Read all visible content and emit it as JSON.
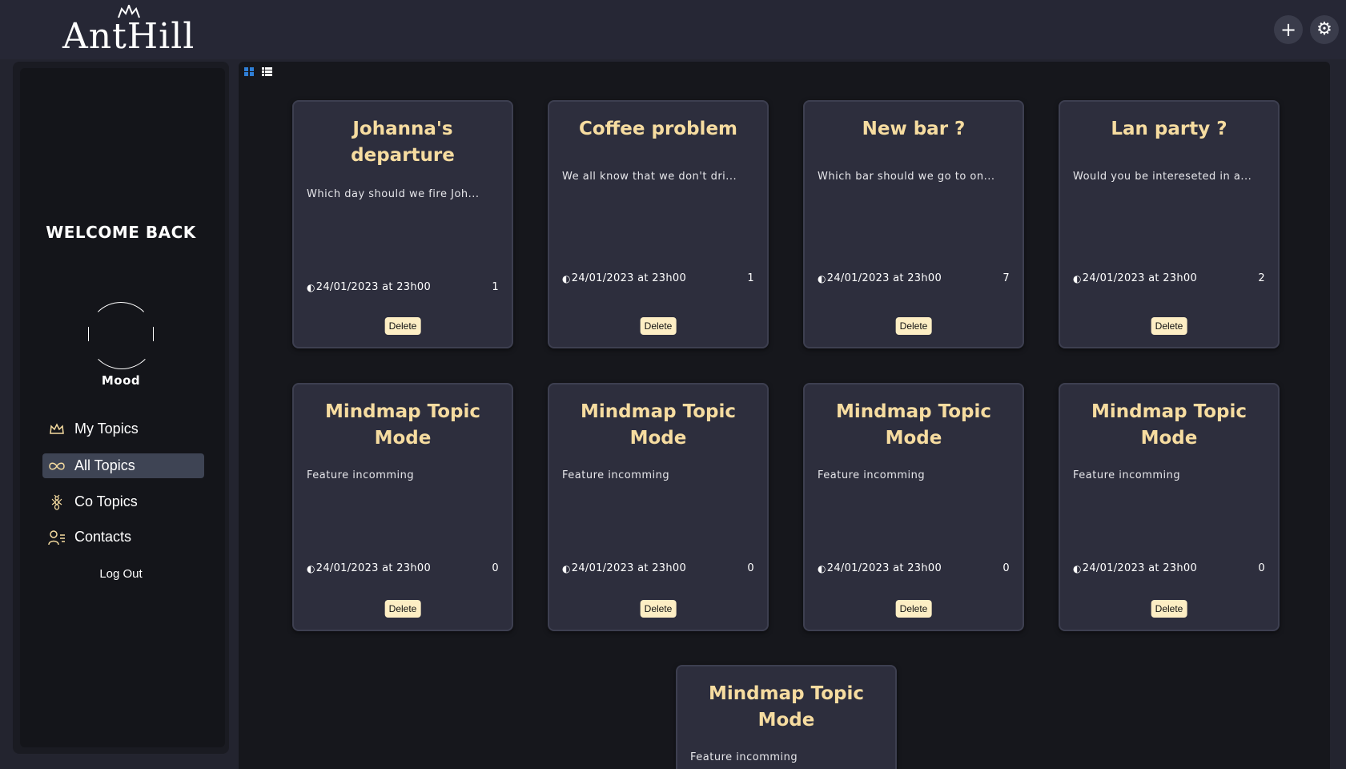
{
  "app": {
    "logo_text": "AntHill"
  },
  "header": {
    "add_symbol": "+",
    "settings_symbol": "⚙"
  },
  "sidebar": {
    "welcome": "WELCOME BACK",
    "mood_label": "Mood",
    "nav": [
      {
        "label": "My Topics",
        "icon": "crown-icon",
        "active": false
      },
      {
        "label": "All Topics",
        "icon": "infinity-icon",
        "active": true
      },
      {
        "label": "Co Topics",
        "icon": "ant-icon",
        "active": false
      },
      {
        "label": "Contacts",
        "icon": "contacts-icon",
        "active": false
      }
    ],
    "logout": "Log Out"
  },
  "view_toggle": {
    "grid_icon": "grid-view-icon",
    "list_icon": "list-view-icon",
    "active": "grid",
    "accent": "#2f7fd6"
  },
  "colors": {
    "title": "#f6dca0",
    "card_bg": "#2d2e3d",
    "delete_bg": "#fdeec4"
  },
  "cards": [
    {
      "title": "Johanna's departure",
      "description": "Which day should we fire Joh...",
      "date": "24/01/2023 at 23h00",
      "count": "1",
      "delete_label": "Delete"
    },
    {
      "title": "Coffee problem",
      "description": "We all know that we don't dri...",
      "date": "24/01/2023 at 23h00",
      "count": "1",
      "delete_label": "Delete"
    },
    {
      "title": "New bar ?",
      "description": "Which bar should we go to on...",
      "date": "24/01/2023 at 23h00",
      "count": "7",
      "delete_label": "Delete"
    },
    {
      "title": "Lan party ?",
      "description": "Would you be intereseted in a...",
      "date": "24/01/2023 at 23h00",
      "count": "2",
      "delete_label": "Delete"
    },
    {
      "title": "Mindmap Topic Mode",
      "description": "Feature incomming",
      "date": "24/01/2023 at 23h00",
      "count": "0",
      "delete_label": "Delete"
    },
    {
      "title": "Mindmap Topic Mode",
      "description": "Feature incomming",
      "date": "24/01/2023 at 23h00",
      "count": "0",
      "delete_label": "Delete"
    },
    {
      "title": "Mindmap Topic Mode",
      "description": "Feature incomming",
      "date": "24/01/2023 at 23h00",
      "count": "0",
      "delete_label": "Delete"
    },
    {
      "title": "Mindmap Topic Mode",
      "description": "Feature incomming",
      "date": "24/01/2023 at 23h00",
      "count": "0",
      "delete_label": "Delete"
    },
    {
      "title": "Mindmap Topic Mode",
      "description": "Feature incomming",
      "date": "",
      "count": "",
      "delete_label": ""
    }
  ]
}
